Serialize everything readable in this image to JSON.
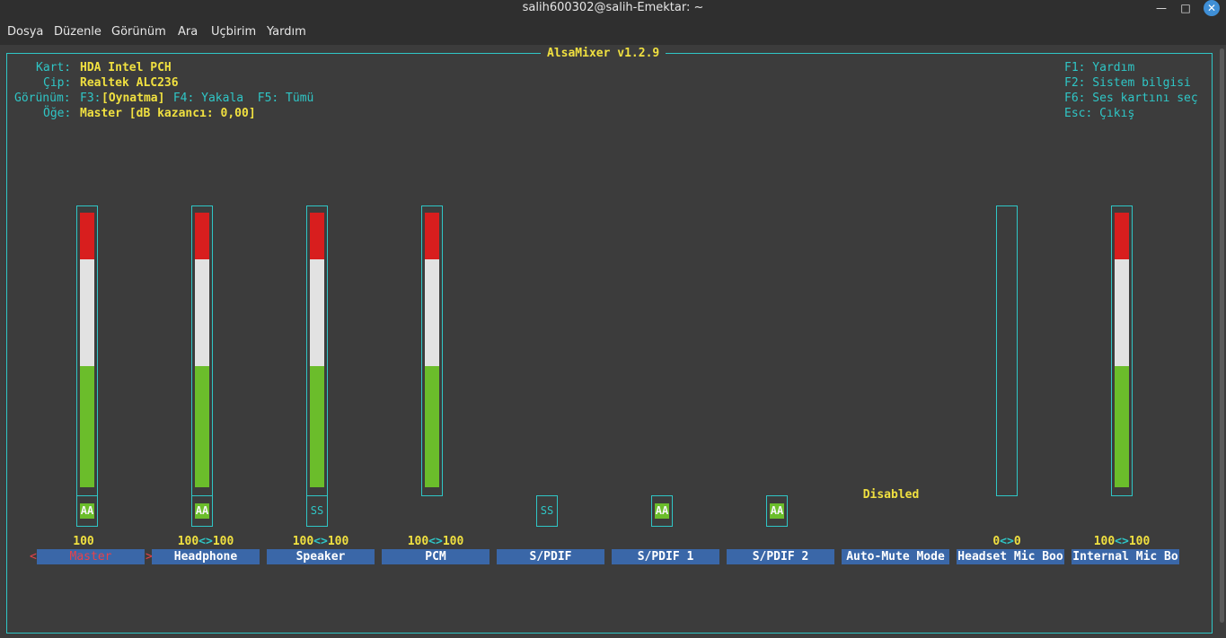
{
  "window": {
    "title": "salih600302@salih-Emektar: ~",
    "minimize_glyph": "—",
    "maximize_glyph": "□",
    "close_glyph": "✕"
  },
  "menu": [
    "Dosya",
    "Düzenle",
    "Görünüm",
    "Ara",
    "Uçbirim",
    "Yardım"
  ],
  "app": {
    "title": "AlsaMixer v1.2.9",
    "info": {
      "card_label": "Kart:",
      "card_value": "HDA Intel PCH",
      "chip_label": "Çip:",
      "chip_value": "Realtek ALC236",
      "view_label": "Görünüm:",
      "view_f3": "F3:",
      "view_f3_value": "[Oynatma]",
      "view_rest": " F4: Yakala  F5: Tümü",
      "item_label": "Öğe:",
      "item_value": "Master [dB kazancı: 0,00]"
    },
    "help": [
      "F1: Yardım",
      "F2: Sistem bilgisi",
      "F6: Ses kartını seç",
      "Esc: Çıkış"
    ],
    "disabled_text": "Disabled",
    "sel_left": "<",
    "sel_right": ">",
    "channels": [
      {
        "name": "Master",
        "level": 1.0,
        "switch": "AA",
        "switch_on": true,
        "value_left": "100",
        "value_sep": "",
        "value_right": "",
        "selected": true
      },
      {
        "name": "Headphone",
        "level": 1.0,
        "switch": "AA",
        "switch_on": true,
        "value_left": "100",
        "value_sep": "<>",
        "value_right": "100"
      },
      {
        "name": "Speaker",
        "level": 1.0,
        "switch": "SS",
        "switch_on": false,
        "value_left": "100",
        "value_sep": "<>",
        "value_right": "100"
      },
      {
        "name": "PCM",
        "level": 1.0,
        "switch": "",
        "value_left": "100",
        "value_sep": "<>",
        "value_right": "100"
      },
      {
        "name": "S/PDIF",
        "switch": "SS",
        "switch_on": false
      },
      {
        "name": "S/PDIF 1",
        "switch": "AA",
        "switch_on": true
      },
      {
        "name": "S/PDIF 2",
        "switch": "AA",
        "switch_on": true
      },
      {
        "name": "Auto-Mute Mode"
      },
      {
        "name": "Headset Mic Boo",
        "level": 0.0,
        "value_left": "0",
        "value_sep": "<>",
        "value_right": "0"
      },
      {
        "name": "Internal Mic Bo",
        "level": 1.0,
        "value_left": "100",
        "value_sep": "<>",
        "value_right": "100"
      }
    ]
  }
}
